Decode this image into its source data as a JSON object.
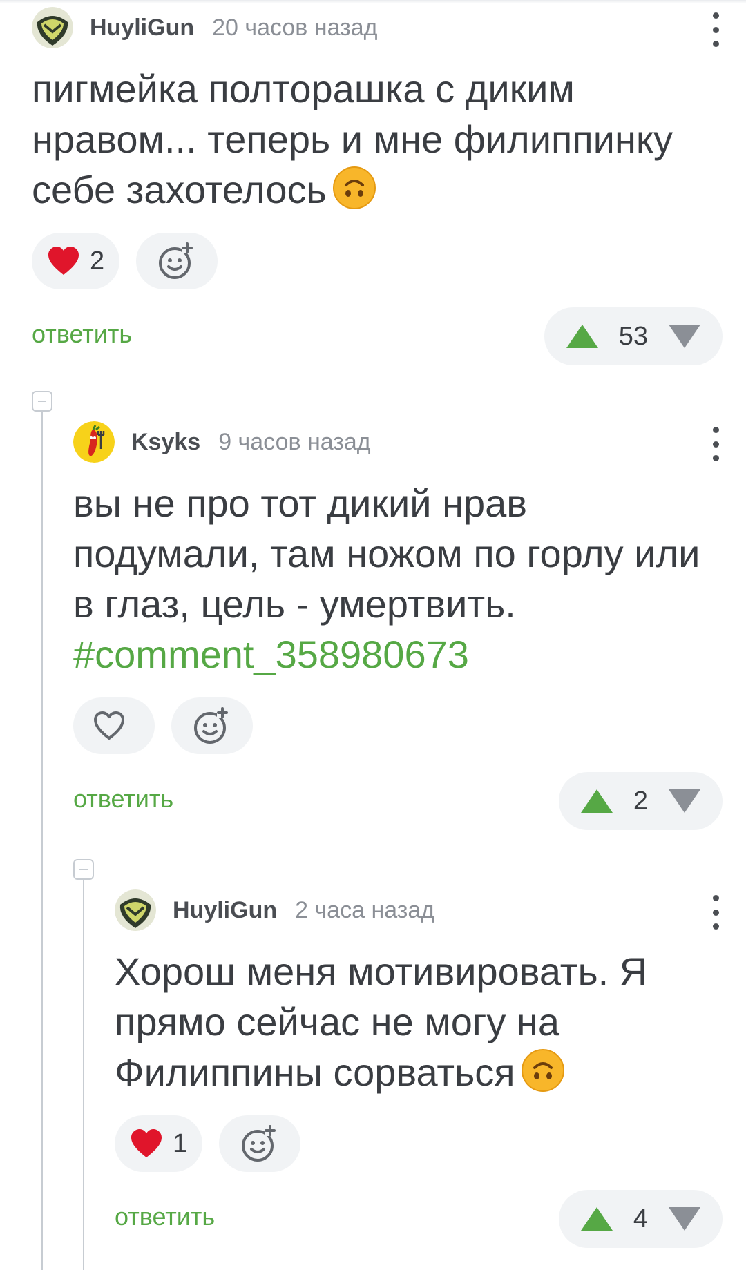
{
  "colors": {
    "accent_green": "#56a845",
    "heart_red": "#e0152b",
    "pill_bg": "#f1f3f5",
    "thread_line": "#c7ccd2"
  },
  "comments": [
    {
      "author": "HuyliGun",
      "time": "20 часов назад",
      "text": "пигмейка полторашка с диким нравом... теперь и мне филиппинку себе захотелось",
      "emoji": "upside-down-face",
      "likes": "2",
      "reply_label": "ответить",
      "rating": "53"
    },
    {
      "author": "Ksyks",
      "time": "9 часов назад",
      "text": "вы не про тот дикий нрав подумали, там ножом по горлу или в глаз, цель - умертвить.",
      "hashtag": "#comment_358980673",
      "likes": "",
      "reply_label": "ответить",
      "rating": "2"
    },
    {
      "author": "HuyliGun",
      "time": "2 часа назад",
      "text": "Хорош меня мотивировать. Я прямо сейчас не могу на Филиппины сорваться",
      "emoji": "upside-down-face",
      "likes": "1",
      "reply_label": "ответить",
      "rating": "4"
    }
  ]
}
